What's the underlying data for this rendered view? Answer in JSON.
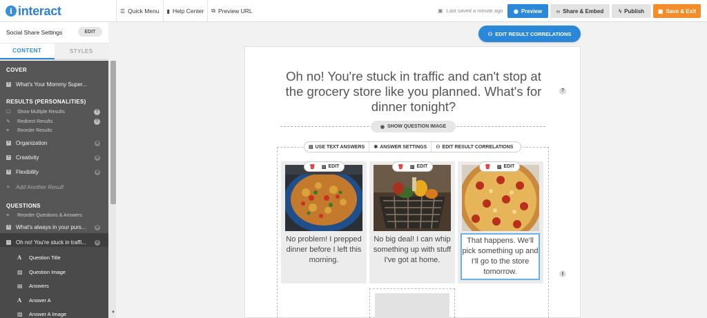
{
  "app": {
    "logo_text": "interact",
    "logo_mark": "i",
    "nav": [
      {
        "label": "Quick Menu",
        "icon": "menu-icon"
      },
      {
        "label": "Help Center",
        "icon": "book-icon"
      },
      {
        "label": "Preview URL",
        "icon": "external-link-icon"
      }
    ],
    "saved_status": "Last saved a minute ago",
    "buttons": {
      "preview": "Preview",
      "share_embed": "Share & Embed",
      "publish": "Publish",
      "save_exit": "Save & Exit"
    }
  },
  "sidebar": {
    "title": "Social Share Settings",
    "edit_label": "EDIT",
    "tabs": [
      "CONTENT",
      "STYLES"
    ],
    "active_tab": "CONTENT",
    "cover": {
      "heading": "COVER",
      "item": "What's Your Mommy Super..."
    },
    "results": {
      "heading": "RESULTS (PERSONALITIES)",
      "options": [
        "Show Multiple Results",
        "Redirect Results",
        "Reorder Results"
      ],
      "items": [
        "Organization",
        "Creativity",
        "Flexibility"
      ],
      "add_label": "Add Another Result"
    },
    "questions": {
      "heading": "QUESTIONS",
      "reorder_label": "Reorder Questions & Answers",
      "items": [
        "What's always in your purs...",
        "Oh no! You're stuck in traffi..."
      ],
      "sub_items": [
        "Question Title",
        "Question Image",
        "Answers",
        "Answer A",
        "Answer A Image"
      ]
    }
  },
  "canvas": {
    "edit_correlations_label": "EDIT RESULT CORRELATIONS",
    "question_title": "Oh no! You're stuck in traffic and can't stop at the grocery store like you planned. What's for dinner tonight?",
    "show_image_label": "SHOW QUESTION IMAGE",
    "toolbar": {
      "use_text_answers": "USE TEXT ANSWERS",
      "answer_settings": "ANSWER SETTINGS",
      "edit_result_correlations": "EDIT RESULT CORRELATIONS"
    },
    "answers": [
      {
        "text": "No problem! I prepped dinner before I left this morning.",
        "edit_label": "EDIT"
      },
      {
        "text": "No big deal! I can whip something up with stuff I've got at home.",
        "edit_label": "EDIT"
      },
      {
        "text": "That happens. We'll pick something up and I'll go to the store tomorrow.",
        "edit_label": "EDIT"
      }
    ]
  },
  "colors": {
    "accent": "#2b88d8",
    "save": "#f48c2a",
    "sidebar_bg": "#565656"
  }
}
